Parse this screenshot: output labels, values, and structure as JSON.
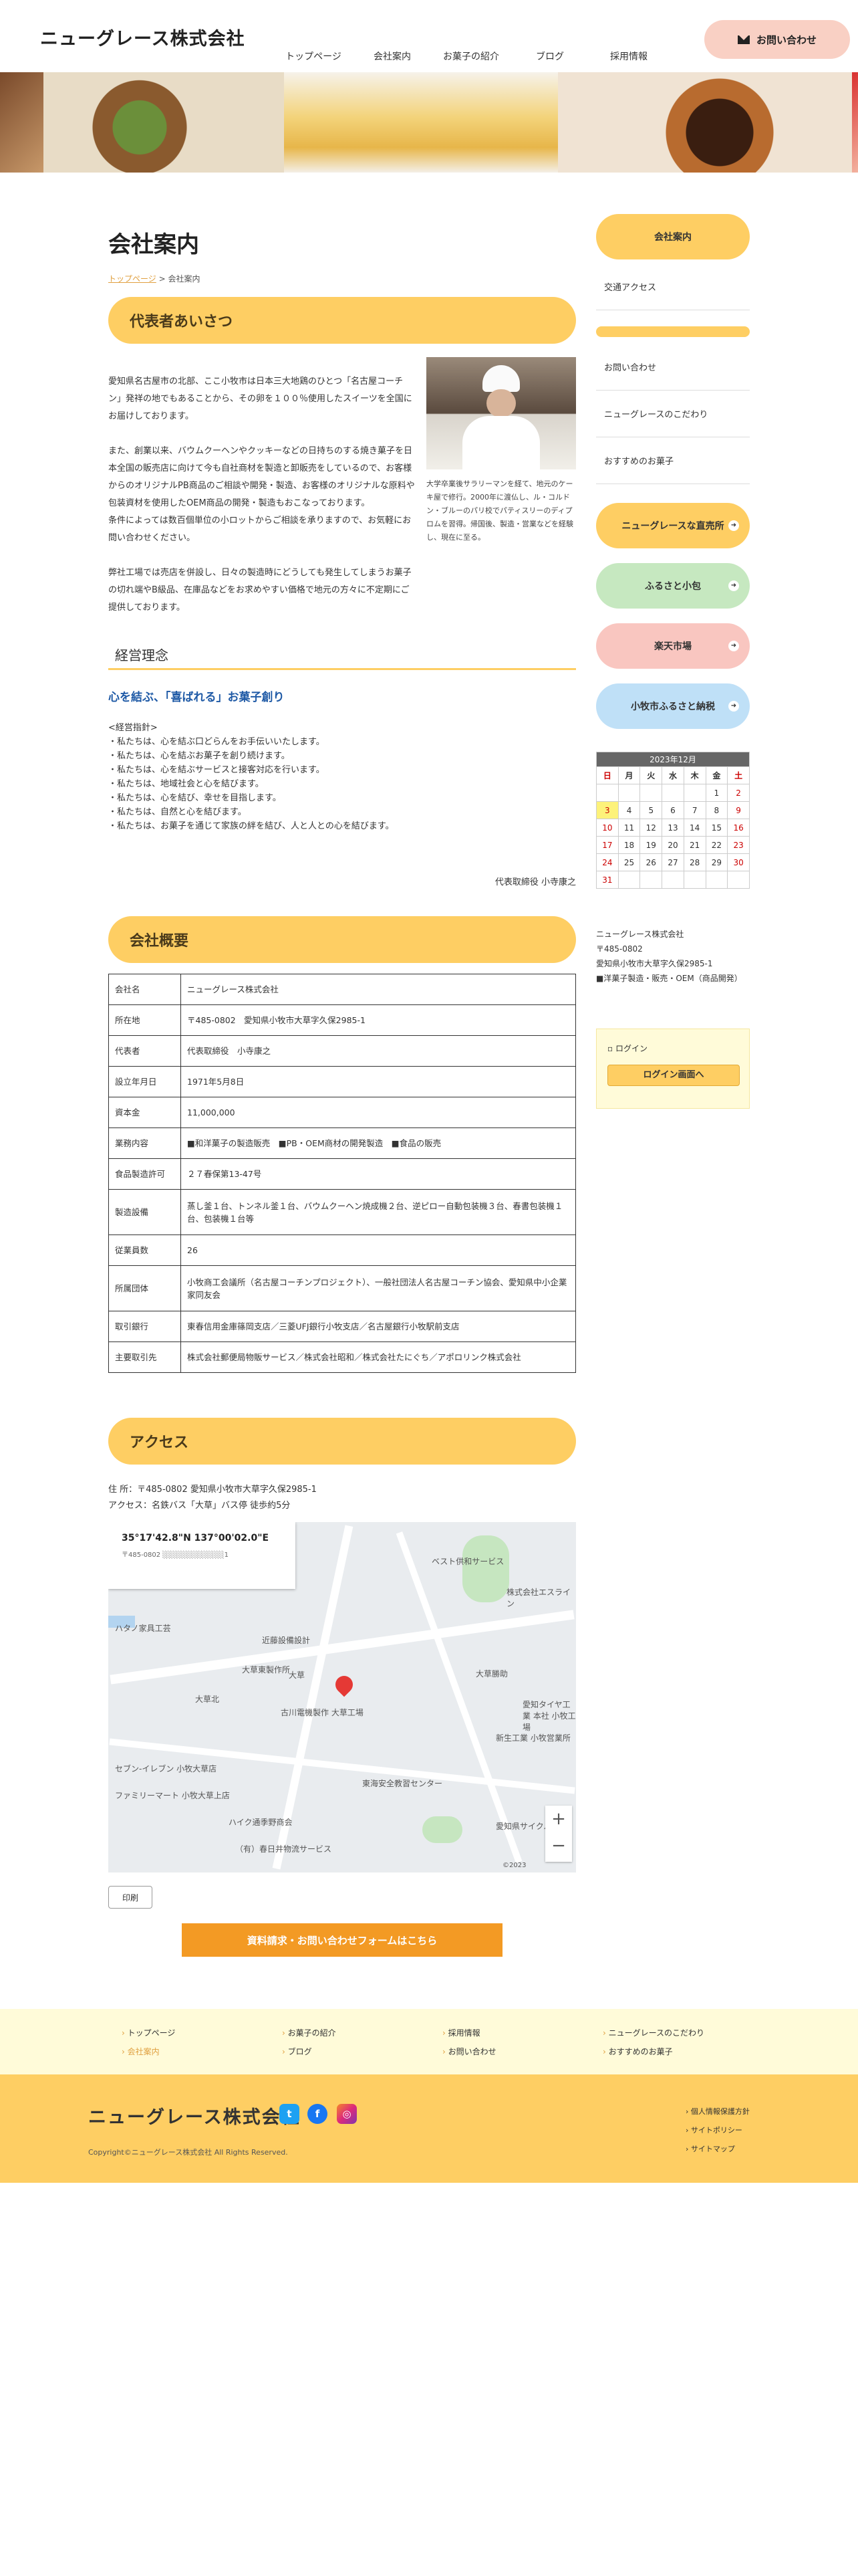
{
  "header": {
    "logo": "ニューグレース株式会社",
    "nav": [
      "トップページ",
      "会社案内",
      "お菓子の紹介",
      "ブログ",
      "採用情報"
    ],
    "contact_label": "お問い合わせ"
  },
  "page": {
    "title": "会社案内",
    "breadcrumb_home": "トップページ",
    "breadcrumb_sep": " > ",
    "breadcrumb_current": "会社案内"
  },
  "greeting": {
    "heading": "代表者あいさつ",
    "paragraphs": [
      "愛知県名古屋市の北部、ここ小牧市は日本三大地鶏のひとつ「名古屋コーチン」発祥の地でもあることから、その卵を１００％使用したスイーツを全国にお届けしております。",
      "また、創業以来、バウムクーヘンやクッキーなどの日持ちのする焼き菓子を日本全国の販売店に向けて今も自社商材を製造と卸販売をしているので、お客様からのオリジナルPB商品のご相談や開発・製造、お客様のオリジナルな原料や包装資材を使用したOEM商品の開発・製造もおこなっております。",
      "条件によっては数百個単位の小ロットからご相談を承りますので、お気軽にお問い合わせください。",
      "弊社工場では売店を併設し、日々の製造時にどうしても発生してしまうお菓子の切れ端やB級品、在庫品などをお求めやすい価格で地元の方々に不定期にご提供しております。"
    ],
    "caption": "大学卒業後サラリーマンを経て、地元のケーキ屋で修行。2000年に渡仏し、ル・コルドン・ブルーのパリ校でパティスリーのディプロムを習得。帰国後、製造・営業などを経験し、現在に至る。"
  },
  "philosophy": {
    "heading": "経営理念",
    "motto": "心を結ぶ、「喜ばれる」お菓子創り",
    "policy_title": "<経営指針>",
    "policies": [
      "・私たちは、心を結ぶ口どらんをお手伝いいたします。",
      "・私たちは、心を結ぶお菓子を創り続けます。",
      "・私たちは、心を結ぶサービスと接客対応を行います。",
      "・私たちは、地域社会と心を結びます。",
      "・私たちは、心を結び、幸せを目指します。",
      "・私たちは、自然と心を結びます。",
      "・私たちは、お菓子を通じて家族の絆を結び、人と人との心を結びます。"
    ],
    "signature": "代表取締役 小寺康之"
  },
  "overview": {
    "heading": "会社概要",
    "rows": [
      {
        "label": "会社名",
        "value": "ニューグレース株式会社"
      },
      {
        "label": "所在地",
        "value": "〒485-0802　愛知県小牧市大草字久保2985-1"
      },
      {
        "label": "代表者",
        "value": "代表取締役　小寺康之"
      },
      {
        "label": "設立年月日",
        "value": "1971年5月8日"
      },
      {
        "label": "資本金",
        "value": "11,000,000"
      },
      {
        "label": "業務内容",
        "value": "■和洋菓子の製造販売　■PB・OEM商材の開発製造　■食品の販売"
      },
      {
        "label": "食品製造許可",
        "value": "２７春保第13-47号"
      },
      {
        "label": "製造設備",
        "value": "蒸し釜１台、トンネル釜１台、バウムクーヘン焼成機２台、逆ピロー自動包装機３台、春書包装機１台、包装機１台等"
      },
      {
        "label": "従業員数",
        "value": "26"
      },
      {
        "label": "所属団体",
        "value": "小牧商工会議所（名古屋コーチンプロジェクト）、一般社団法人名古屋コーチン協会、愛知県中小企業家同友会"
      },
      {
        "label": "取引銀行",
        "value": "東春信用金庫篠岡支店／三菱UFJ銀行小牧支店／名古屋銀行小牧駅前支店"
      },
      {
        "label": "主要取引先",
        "value": "株式会社郵便局物販サービス／株式会社昭和／株式会社たにぐち／アポロリンク株式会社"
      }
    ]
  },
  "access": {
    "heading": "アクセス",
    "address": "住 所：〒485-0802 愛知県小牧市大草字久保2985-1",
    "route": "アクセス：名鉄バス「大草」バス停 徒歩約5分",
    "map_coords": "35°17'42.8\"N 137°00'02.0\"E",
    "map_addr": "〒485-0802 ░░░░░░░░░░░░1",
    "map_labels": [
      "ベスト供和サービス",
      "株式会社エスライン",
      "ハタノ家具工芸",
      "近藤設備設計",
      "大草",
      "大草東製作所",
      "大草北",
      "古川電機製作 大草工場",
      "大草勝助",
      "愛知タイヤ工業 本社 小牧工場",
      "新生工業 小牧営業所",
      "セブン-イレブン 小牧大草店",
      "ファミリーマート 小牧大草上店",
      "東海安全教習センター",
      "ハイク通季野商会",
      "（有）春日井物流サービス",
      "愛知県サイクル工業"
    ],
    "map_copyright": "©2023",
    "print_label": "印刷",
    "form_label": "資料請求・お問い合わせフォームはこちら"
  },
  "sidebar": {
    "active_label": "会社案内",
    "links_top": [
      "交通アクセス"
    ],
    "links_bottom": [
      "お問い合わせ",
      "ニューグレースのこだわり",
      "おすすめのお菓子"
    ],
    "pills": [
      {
        "label": "ニューグレースな直売所",
        "color": "#fece63"
      },
      {
        "label": "ふるさと小包",
        "color": "#c6e8c0"
      },
      {
        "label": "楽天市場",
        "color": "#f9c6c0"
      },
      {
        "label": "小牧市ふるさと納税",
        "color": "#bfe0f7"
      }
    ],
    "calendar": {
      "title": "2023年12月",
      "weekdays": [
        "日",
        "月",
        "火",
        "水",
        "木",
        "金",
        "土"
      ],
      "weeks": [
        [
          "",
          "",
          "",
          "",
          "",
          "1",
          "2"
        ],
        [
          "3",
          "4",
          "5",
          "6",
          "7",
          "8",
          "9"
        ],
        [
          "10",
          "11",
          "12",
          "13",
          "14",
          "15",
          "16"
        ],
        [
          "17",
          "18",
          "19",
          "20",
          "21",
          "22",
          "23"
        ],
        [
          "24",
          "25",
          "26",
          "27",
          "28",
          "29",
          "30"
        ],
        [
          "31",
          "",
          "",
          "",
          "",
          "",
          ""
        ]
      ],
      "today": "3"
    },
    "address_lines": [
      "ニューグレース株式会社",
      "〒485-0802",
      "愛知県小牧市大草字久保2985-1",
      "■洋菓子製造・販売・OEM（商品開発）"
    ],
    "login_title": "ログイン",
    "login_button": "ログイン画面へ"
  },
  "footer": {
    "nav_cols": [
      [
        "トップページ",
        "会社案内"
      ],
      [
        "お菓子の紹介",
        "ブログ"
      ],
      [
        "採用情報",
        "お問い合わせ"
      ],
      [
        "ニューグレースのこだわり",
        "おすすめのお菓子"
      ]
    ],
    "logo": "ニューグレース株式会社",
    "copyright": "Copyright©ニューグレース株式会社 All Rights Reserved.",
    "links": [
      "個人情報保護方針",
      "サイトポリシー",
      "サイトマップ"
    ]
  }
}
